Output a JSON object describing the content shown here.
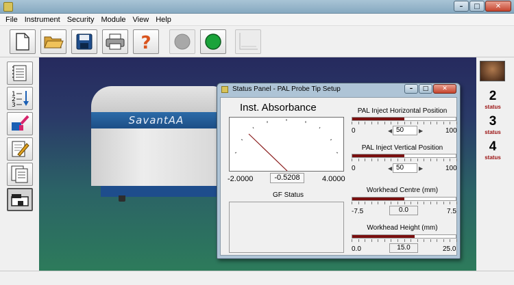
{
  "menu": [
    "File",
    "Instrument",
    "Security",
    "Module",
    "View",
    "Help"
  ],
  "window_controls": {
    "minimize": "–",
    "maximize": "□",
    "close": "✕"
  },
  "toolbar": {
    "icons": [
      "new-document-icon",
      "open-folder-icon",
      "save-icon",
      "print-icon",
      "help-icon",
      "stop-icon",
      "start-icon",
      "graph-icon"
    ]
  },
  "left_toolbar": {
    "icons": [
      "notebook-icon",
      "sequence-icon",
      "sample-vials-icon",
      "edit-icon",
      "report-icon",
      "instrument-icon"
    ]
  },
  "instrument": {
    "label": "SavantAA"
  },
  "status_panel": {
    "title": "Status Panel - PAL Probe Tip Setup",
    "gauge": {
      "title": "Inst. Absorbance",
      "min": "-2.0000",
      "value": "-0.5208",
      "max": "4.0000"
    },
    "gf_status": {
      "label": "GF Status"
    },
    "controls": [
      {
        "label": "PAL Inject Horizontal Position",
        "min": "0",
        "max": "100",
        "value": "50",
        "level": 0.5
      },
      {
        "label": "PAL Inject Vertical Position",
        "min": "0",
        "max": "100",
        "value": "50",
        "level": 0.5
      },
      {
        "label": "Workhead Centre (mm)",
        "min": "-7.5",
        "max": "7.5",
        "value": "0.0",
        "level": 0.5
      },
      {
        "label": "Workhead Height (mm)",
        "min": "0.0",
        "max": "25.0",
        "value": "15.0",
        "level": 0.6
      }
    ]
  },
  "right_panel": {
    "statuses": [
      {
        "number": "2",
        "label": "status"
      },
      {
        "number": "3",
        "label": "status"
      },
      {
        "number": "4",
        "label": "status"
      }
    ]
  }
}
